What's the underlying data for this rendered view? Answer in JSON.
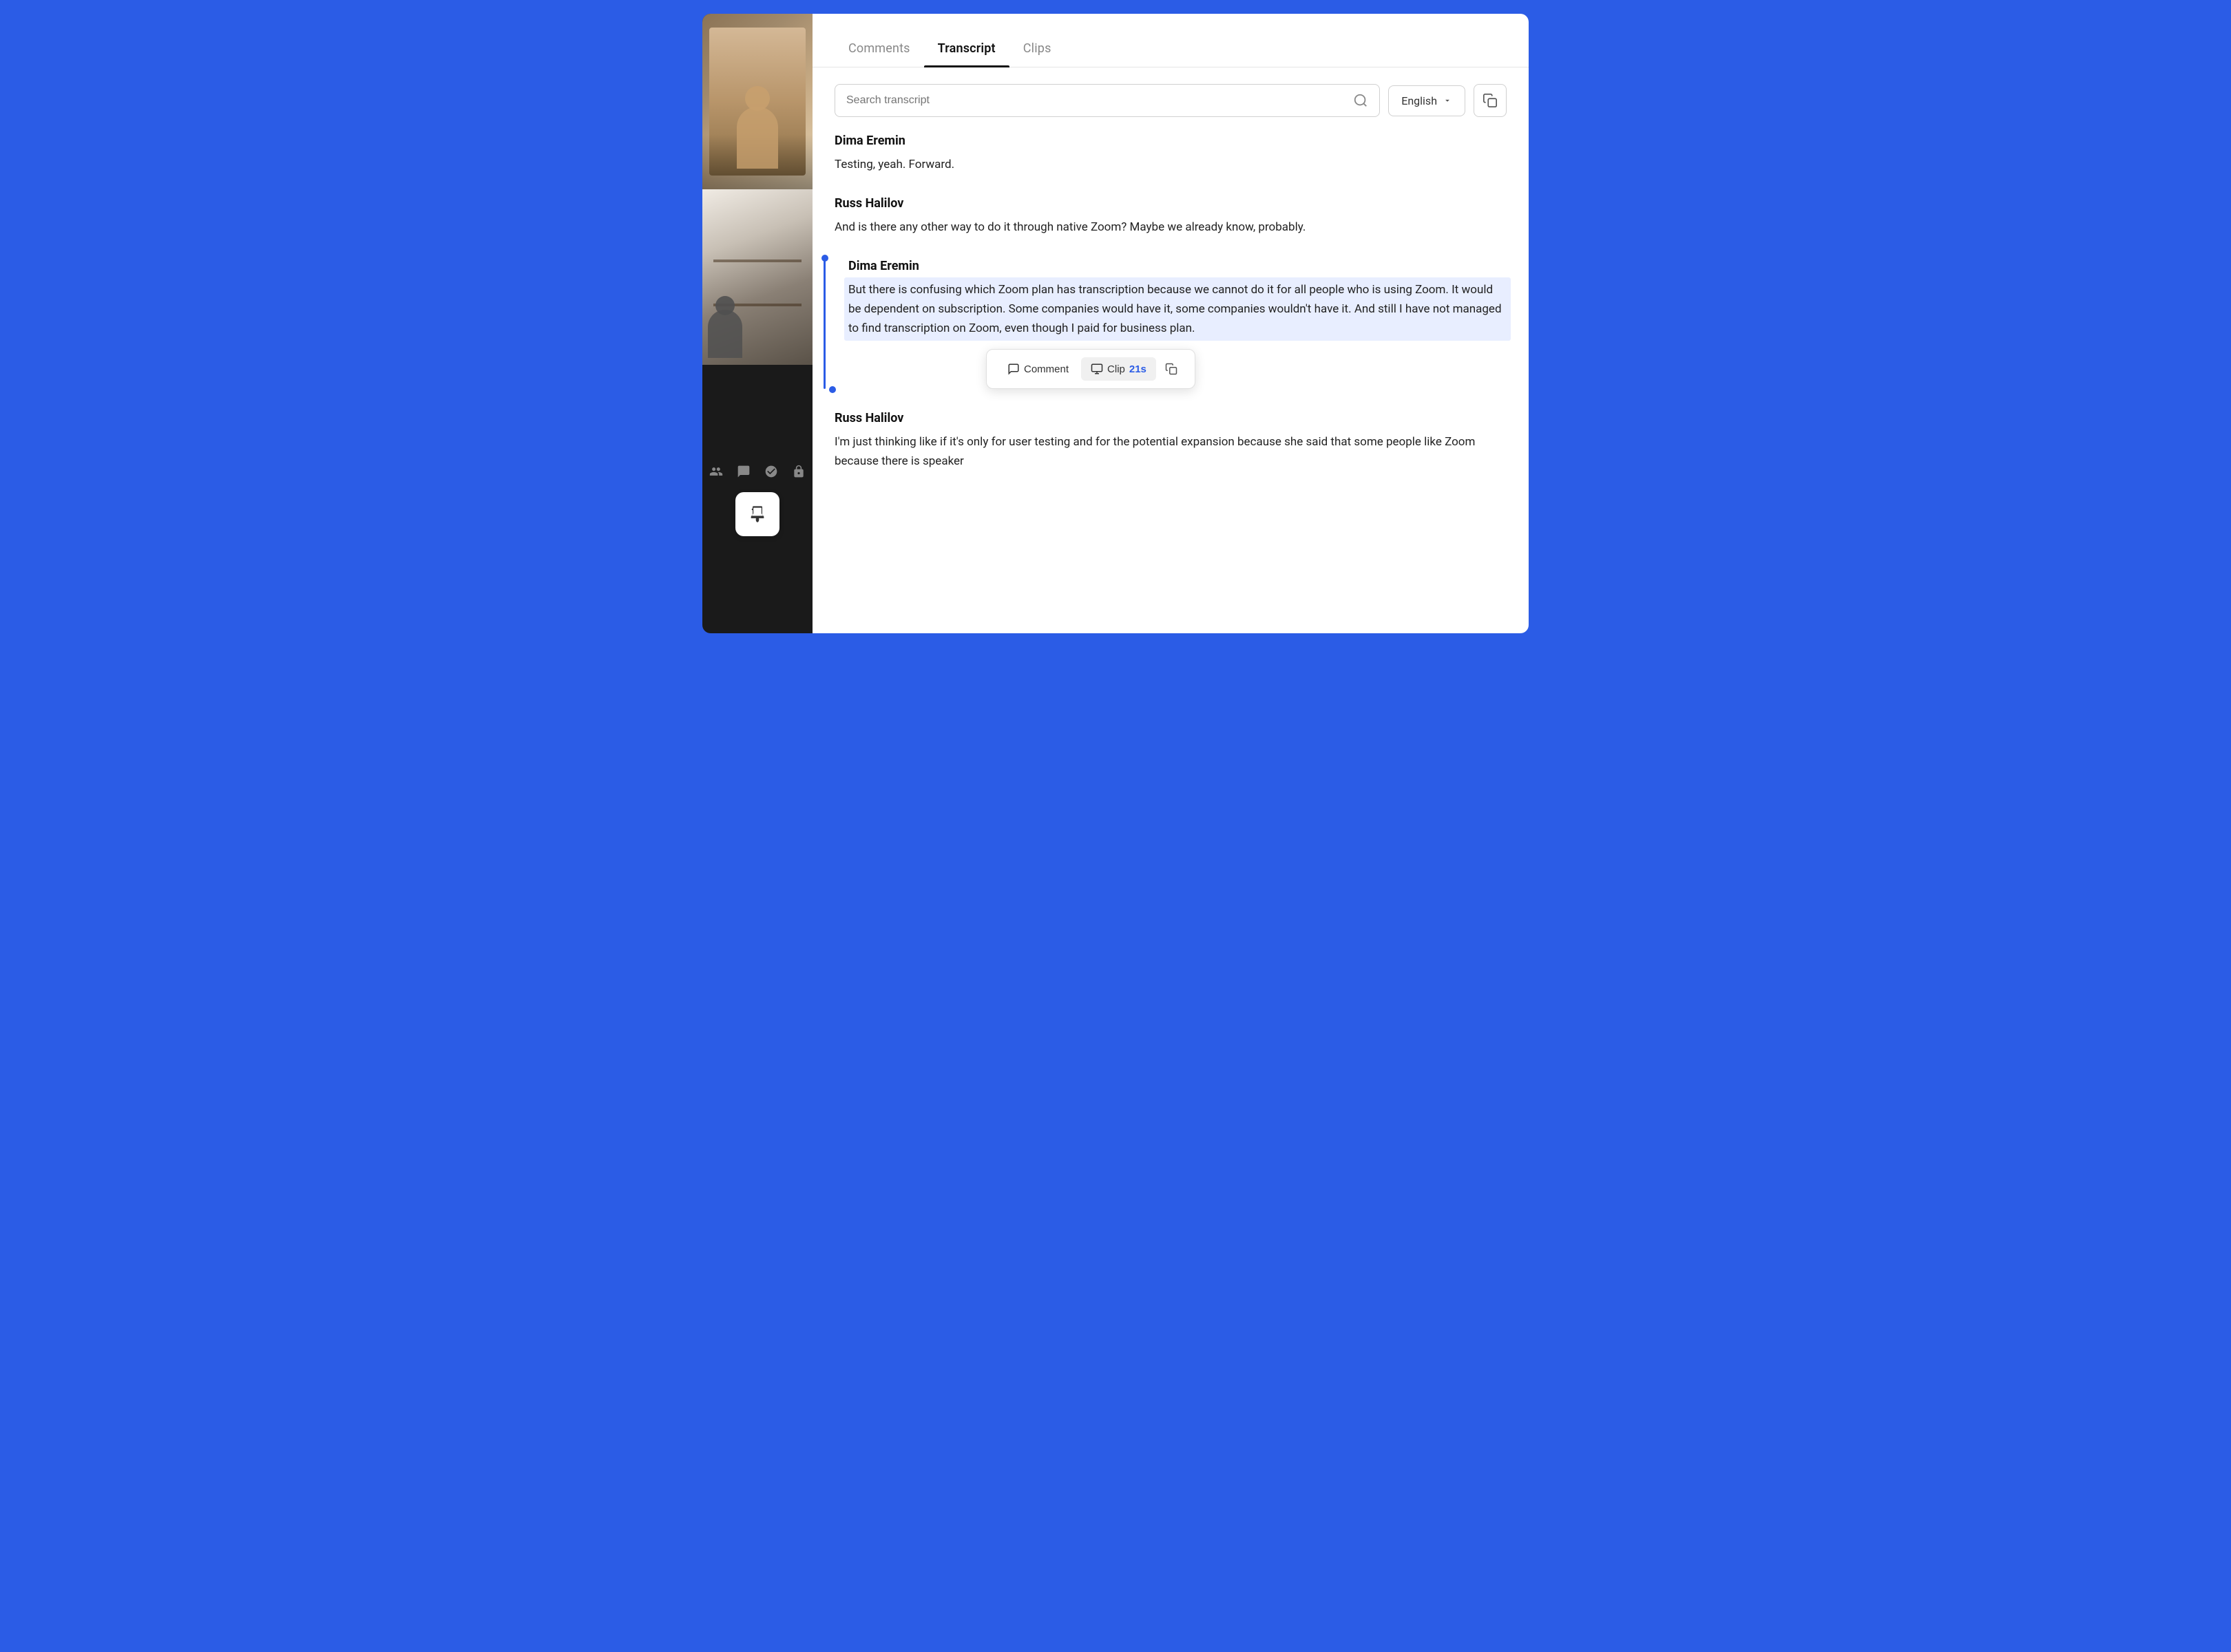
{
  "tabs": {
    "items": [
      {
        "label": "Comments",
        "active": false
      },
      {
        "label": "Transcript",
        "active": true
      },
      {
        "label": "Clips",
        "active": false
      }
    ]
  },
  "search": {
    "placeholder": "Search transcript",
    "value": ""
  },
  "language": {
    "selected": "English"
  },
  "transcript": {
    "entries": [
      {
        "id": "entry-1",
        "speaker": "Dima Eremin",
        "text": "Testing, yeah. Forward.",
        "highlighted": false
      },
      {
        "id": "entry-2",
        "speaker": "Russ Halilov",
        "text": "And is there any other way to do it through native Zoom? Maybe we already know, probably.",
        "highlighted": false
      },
      {
        "id": "entry-3",
        "speaker": "Dima Eremin",
        "text": "But there is confusing which Zoom plan has transcription because we cannot do it for all people who is using Zoom. It would be dependent on subscription. Some companies would have it, some companies wouldn't have it. And still I have not managed to find transcription on Zoom, even though I paid for business plan.",
        "highlighted": true
      },
      {
        "id": "entry-4",
        "speaker": "Russ Halilov",
        "text": "I'm just thinking like if it's only for user testing and for the potential expansion because she said that some people like Zoom because there is speaker",
        "highlighted": false
      }
    ]
  },
  "toolbar": {
    "comment_label": "Comment",
    "clip_label": "Clip",
    "clip_duration": "21s",
    "copy_tooltip": "Copy"
  },
  "icons": {
    "search": "⌕",
    "chevron_down": "▾",
    "copy": "⧉",
    "comment": "💬",
    "clip": "▶",
    "pin": "📌",
    "people": "👥",
    "chat": "💬",
    "org": "⚙",
    "lock": "🔒"
  }
}
